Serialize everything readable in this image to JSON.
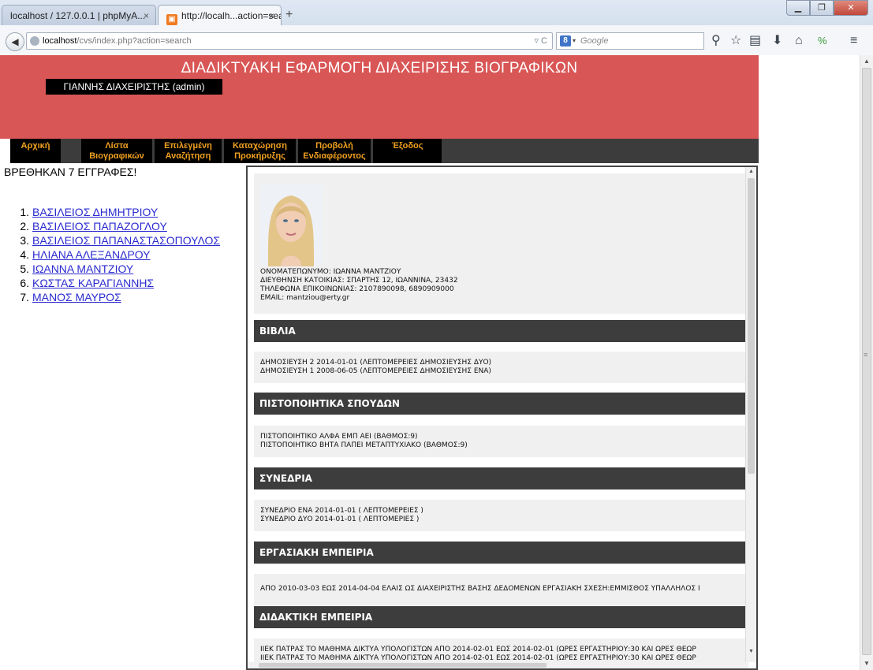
{
  "browser": {
    "tabs": [
      {
        "label": "localhost / 127.0.0.1 | phpMyA...",
        "active": false
      },
      {
        "label": "http://localh...action=search",
        "active": true
      }
    ],
    "url_host": "localhost",
    "url_path": "/cvs/index.php?action=search",
    "search_placeholder": "Google",
    "new_tab_symbol": "+",
    "close_tab_symbol": "×"
  },
  "site": {
    "title": "ΔΙΑΔΙΚΤΥΑΚΗ ΕΦΑΡΜΟΓΗ ΔΙΑΧΕΙΡΙΣΗΣ ΒΙΟΓΡΑΦΙΚΩΝ",
    "user": "ΓΙΑΝΝΗΣ ΔΙΑΧΕΙΡΙΣΤΗΣ (admin)",
    "header_color": "#d95656",
    "menu_text_color": "#f0a020"
  },
  "menu": {
    "items": [
      {
        "line1": "Αρχική",
        "line2": ""
      },
      {
        "line1": "Λίστα",
        "line2": "Βιογραφικών"
      },
      {
        "line1": "Επιλεγμένη",
        "line2": "Αναζήτηση"
      },
      {
        "line1": "Καταχώρηση",
        "line2": "Προκήρυξης"
      },
      {
        "line1": "Προβολή",
        "line2": "Ενδιαφέροντος"
      },
      {
        "line1": "Έξοδος",
        "line2": ""
      }
    ]
  },
  "results": {
    "found_text": "ΒΡΕΘΗΚΑΝ 7 ΕΓΓΡΑΦΕΣ!",
    "items": [
      {
        "num": "1.",
        "name": "ΒΑΣΙΛΕΙΟΣ ΔΗΜΗΤΡΙΟΥ"
      },
      {
        "num": "2.",
        "name": "ΒΑΣΙΛΕΙΟΣ ΠΑΠΑΖΟΓΛΟΥ"
      },
      {
        "num": "3.",
        "name": "ΒΑΣΙΛΕΙΟΣ ΠΑΠΑΝΑΣΤΑΣΟΠΟΥΛΟΣ"
      },
      {
        "num": "4.",
        "name": "ΗΛΙΑΝΑ ΑΛΕΞΑΝΔΡΟΥ"
      },
      {
        "num": "5.",
        "name": "ΙΩΑΝΝΑ ΜΑΝΤΖΙΟΥ"
      },
      {
        "num": "6.",
        "name": "ΚΩΣΤΑΣ ΚΑΡΑΓΙΑΝΝΗΣ"
      },
      {
        "num": "7.",
        "name": "ΜΑΝΟΣ ΜΑΥΡΟΣ"
      }
    ]
  },
  "cv": {
    "personal": {
      "name": "ΟΝΟΜΑΤΕΠΩΝΥΜΟ: ΙΩΑΝΝΑ ΜΑΝΤΖΙΟΥ",
      "address": "ΔΙΕΥΘΗΝΣΗ ΚΑΤΟΙΚΙΑΣ: ΣΠΑΡΤΗΣ 12, ΙΩΑΝΝΙΝΑ, 23432",
      "phones": "ΤΗΛΕΦΩΝΑ ΕΠΙΚΟΙΝΩΝΙΑΣ: 2107890098, 6890909000",
      "email": "EMAIL: mantziou@erty.gr"
    },
    "sections": [
      {
        "title": "ΒΙΒΛΙΑ",
        "lines": [
          "ΔΗΜΟΣΙΕΥΣΗ 2 2014-01-01 (ΛΕΠΤΟΜΕΡΕΙΕΣ ΔΗΜΟΣΙΕΥΣΗΣ ΔΥΟ)",
          "ΔΗΜΟΣΙΕΥΣΗ 1 2008-06-05 (ΛΕΠΤΟΜΕΡΕΙΕΣ ΔΗΜΟΣΙΕΥΣΗΣ ΕΝΑ)"
        ]
      },
      {
        "title": "ΠΙΣΤΟΠΟΙΗΤΙΚΑ ΣΠΟΥΔΩΝ",
        "lines": [
          "ΠΙΣΤΟΠΟΙΗΤΙΚΟ ΑΛΦΑ ΕΜΠ ΑΕΙ (ΒΑΘΜΟΣ:9)",
          "ΠΙΣΤΟΠΟΙΗΤΙΚΟ ΒΗΤΑ ΠΑΠΕΙ ΜΕΤΑΠΤΥΧΙΑΚΟ (ΒΑΘΜΟΣ:9)"
        ]
      },
      {
        "title": "ΣΥΝΕΔΡΙΑ",
        "lines": [
          "ΣΥΝΕΔΡΙΟ ΕΝΑ 2014-01-01 ( ΛΕΠΤΟΜΕΡΕΙΕΣ )",
          "ΣΥΝΕΔΡΙΟ ΔΥΟ 2014-01-01 ( ΛΕΠΤΟΜΕΡΙΕΣ )"
        ]
      },
      {
        "title": "ΕΡΓΑΣΙΑΚΗ ΕΜΠΕΙΡΙΑ",
        "lines": [
          "ΑΠΟ 2010-03-03 ΕΩΣ 2014-04-04 ΕΛΑΙΣ ΩΣ ΔΙΑΧΕΙΡΙΣΤΗΣ ΒΑΣΗΣ ΔΕΔΟΜΕΝΩΝ ΕΡΓΑΣΙΑΚΗ ΣΧΕΣΗ:ΕΜΜΙΣΘΟΣ ΥΠΑΛΛΗΛΟΣ Ι"
        ]
      },
      {
        "title": "ΔΙΔΑΚΤΙΚΗ ΕΜΠΕΙΡΙΑ",
        "lines": [
          "ΙΙΕΚ ΠΑΤΡΑΣ ΤΟ ΜΑΘΗΜΑ ΔΙΚΤΥΑ ΥΠΟΛΟΓΙΣΤΩΝ ΑΠΟ 2014-02-01 ΕΩΣ 2014-02-01 (ΩΡΕΣ ΕΡΓΑΣΤΗΡΙΟΥ:30 ΚΑΙ ΩΡΕΣ ΘΕΩΡ",
          "ΙΙΕΚ ΠΑΤΡΑΣ ΤΟ ΜΑΘΗΜΑ ΔΙΚΤΥΑ ΥΠΟΛΟΓΙΣΤΩΝ ΑΠΟ 2014-02-01 ΕΩΣ 2014-02-01 (ΩΡΕΣ ΕΡΓΑΣΤΗΡΙΟΥ:30 ΚΑΙ ΩΡΕΣ ΘΕΩΡ"
        ]
      }
    ]
  }
}
